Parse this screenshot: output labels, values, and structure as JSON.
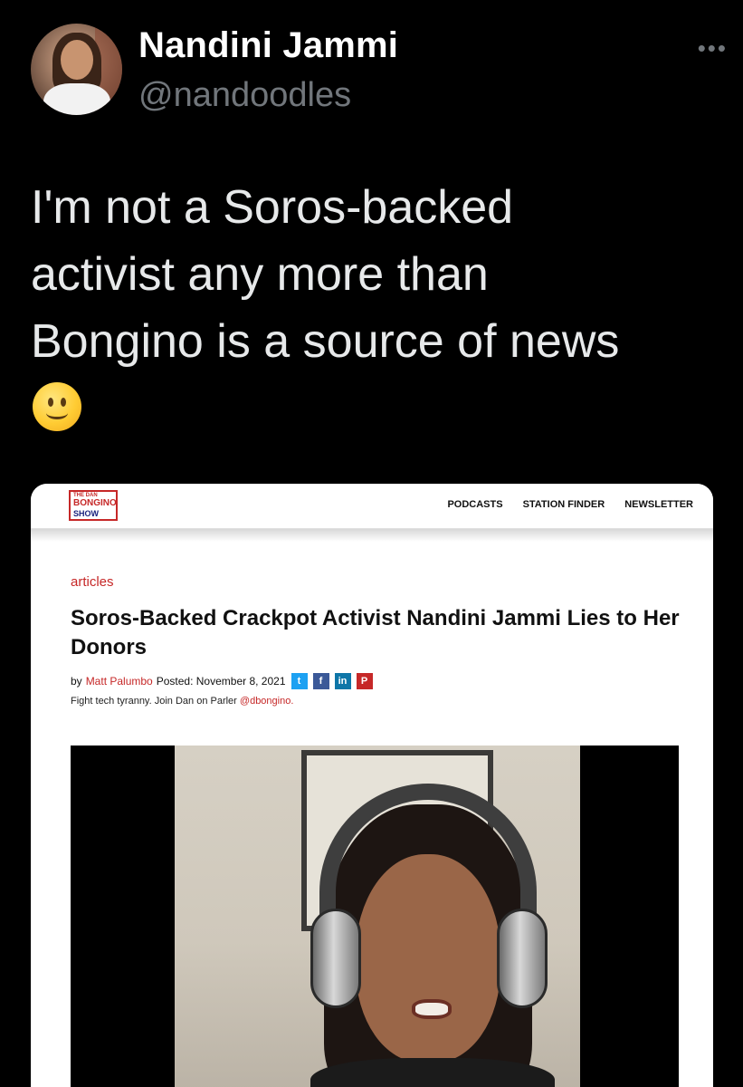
{
  "tweet": {
    "author_name": "Nandini Jammi",
    "author_handle": "@nandoodles",
    "more_icon": "more-horizontal-icon",
    "text_line_1": "I'm not a Soros-backed",
    "text_line_2": "activist any more than",
    "text_line_3": "Bongino is a source of news",
    "emoji": "slightly-smiling-face"
  },
  "embedded_screenshot": {
    "site": {
      "logo_top": "THE DAN",
      "logo_main": "BONGINO",
      "logo_bottom": "SHOW",
      "nav": [
        "PODCASTS",
        "STATION FINDER",
        "NEWSLETTER"
      ]
    },
    "article": {
      "category": "articles",
      "headline": "Soros-Backed Crackpot Activist Nandini Jammi Lies to Her Donors",
      "by_prefix": "by",
      "author": "Matt Palumbo",
      "posted": "Posted: November 8, 2021",
      "share_icons": [
        "twitter-icon",
        "facebook-icon",
        "linkedin-icon",
        "parler-icon"
      ],
      "promo_text": "Fight tech tyranny. Join Dan on Parler",
      "promo_handle": "@dbongino."
    }
  }
}
